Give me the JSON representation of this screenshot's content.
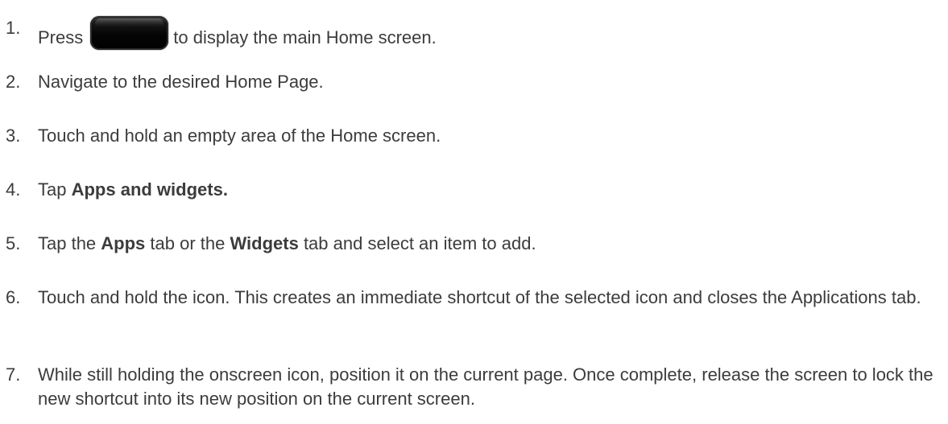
{
  "steps": [
    {
      "num": "1.",
      "before": "Press",
      "after": "to display the main Home screen."
    },
    {
      "num": "2.",
      "text": "Navigate to the desired Home Page."
    },
    {
      "num": "3.",
      "text": "Touch and hold an empty area of the Home screen."
    },
    {
      "num": "4.",
      "before": "Tap ",
      "bold": "Apps and widgets."
    },
    {
      "num": "5.",
      "before": "Tap the ",
      "bold1": "Apps",
      "middle": " tab or the ",
      "bold2": "Widgets",
      "after": " tab and select an item to add."
    },
    {
      "num": "6.",
      "text": "Touch and hold the icon. This creates an immediate shortcut of the selected icon and closes the Applications tab."
    },
    {
      "num": "7.",
      "text": "While still holding the onscreen icon, position it on the current page. Once complete, release the screen to lock the new shortcut into its new position on the current screen."
    }
  ],
  "icons": {
    "home_key": "home-key-icon"
  }
}
